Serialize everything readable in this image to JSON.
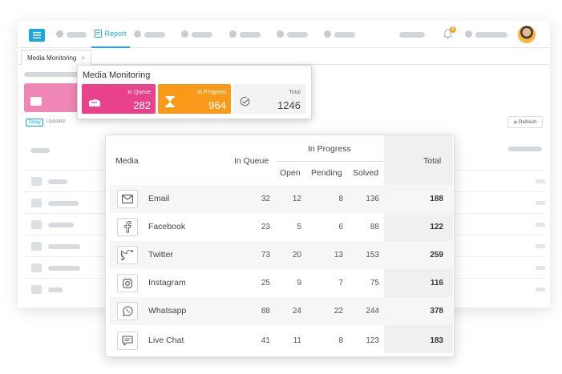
{
  "header": {
    "report_tab_label": "Report"
  },
  "doc_tab": {
    "label": "Media Monitoring",
    "close": "×"
  },
  "filters": {
    "today_label": "Today",
    "updated_label": "Updated:",
    "refresh_label": "Refresh"
  },
  "notification": {
    "count": "8"
  },
  "summary": {
    "title": "Media Monitoring",
    "in_queue": {
      "label": "In Queue",
      "value": "282"
    },
    "in_progress": {
      "label": "In Progress",
      "value": "964"
    },
    "total": {
      "label": "Total",
      "value": "1246"
    }
  },
  "table": {
    "headers": {
      "media": "Media",
      "in_queue": "In Queue",
      "in_progress": "In Progress",
      "open": "Open",
      "pending": "Pending",
      "solved": "Solved",
      "total": "Total"
    },
    "rows": [
      {
        "icon": "email-icon",
        "name": "Email",
        "in_queue": "32",
        "open": "12",
        "pending": "8",
        "solved": "136",
        "total": "188"
      },
      {
        "icon": "facebook-icon",
        "name": "Facebook",
        "in_queue": "23",
        "open": "5",
        "pending": "6",
        "solved": "88",
        "total": "122"
      },
      {
        "icon": "twitter-icon",
        "name": "Twitter",
        "in_queue": "73",
        "open": "20",
        "pending": "13",
        "solved": "153",
        "total": "259"
      },
      {
        "icon": "instagram-icon",
        "name": "Instagram",
        "in_queue": "25",
        "open": "9",
        "pending": "7",
        "solved": "75",
        "total": "116"
      },
      {
        "icon": "whatsapp-icon",
        "name": "Whatsapp",
        "in_queue": "88",
        "open": "24",
        "pending": "22",
        "solved": "244",
        "total": "378"
      },
      {
        "icon": "live-chat-icon",
        "name": "Live Chat",
        "in_queue": "41",
        "open": "11",
        "pending": "8",
        "solved": "123",
        "total": "183"
      }
    ]
  },
  "colors": {
    "accent": "#1ea7d9",
    "in_queue": "#e8428c",
    "in_progress": "#fa9a1b",
    "total_card": "#f3f3f3"
  }
}
